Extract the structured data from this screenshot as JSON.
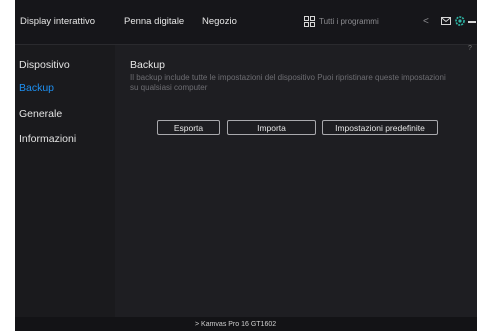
{
  "tabs": [
    {
      "label": "Display interattivo"
    },
    {
      "label": "Penna digitale"
    },
    {
      "label": "Negozio"
    }
  ],
  "programs": {
    "label": "Tutti i programmi",
    "icon": "grid-icon"
  },
  "window_controls": {
    "back": "<",
    "icons": [
      "mail-icon",
      "gear-icon",
      "minimize-icon",
      "close-icon"
    ]
  },
  "sidebar": {
    "items": [
      {
        "label": "Dispositivo",
        "active": false
      },
      {
        "label": "Backup",
        "active": true
      },
      {
        "label": "Generale",
        "active": false
      },
      {
        "label": "Informazioni",
        "active": false
      }
    ]
  },
  "main": {
    "help": "?",
    "title": "Backup",
    "description": "Il backup include tutte le impostazioni del dispositivo Puoi ripristinare queste impostazioni su qualsiasi computer",
    "buttons": {
      "export": "Esporta",
      "import": "Importa",
      "defaults": "Impostazioni predefinite"
    }
  },
  "footer": {
    "device": "> Kamvas Pro 16 GT1602"
  },
  "colors": {
    "accent": "#1d8ff0",
    "background": "#1e1e22",
    "topbar": "#16161a",
    "gear": "#2fb8a8"
  }
}
